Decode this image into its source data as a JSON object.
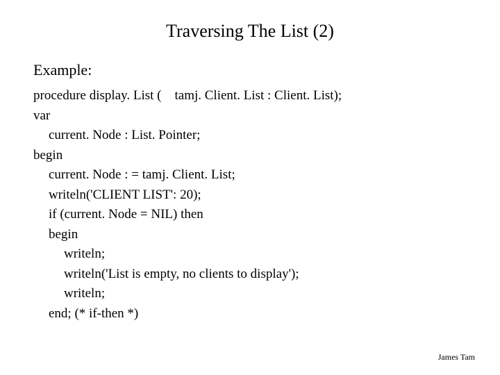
{
  "title": "Traversing The List (2)",
  "example_label": "Example:",
  "code": {
    "line1": "procedure display. List (    tamj. Client. List : Client. List);",
    "line2": "var",
    "line3": "current. Node : List. Pointer;",
    "line4": "begin",
    "line5": "current. Node : = tamj. Client. List;",
    "line6": "writeln('CLIENT LIST': 20);",
    "line7": "if (current. Node = NIL) then",
    "line8": "begin",
    "line9": "writeln;",
    "line10": "writeln('List is empty, no clients to display');",
    "line11": "writeln;",
    "line12": "end; (* if-then *)"
  },
  "footer": "James Tam"
}
